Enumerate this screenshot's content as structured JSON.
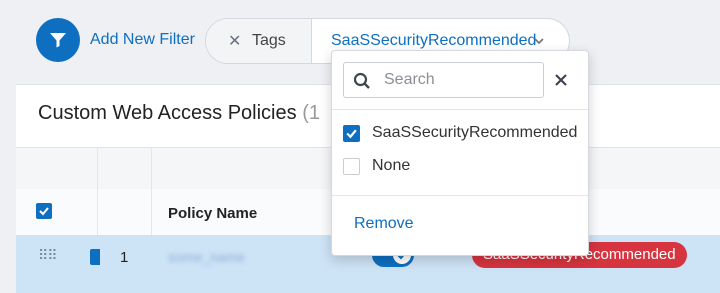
{
  "filter_bar": {
    "add_filter_label": "Add New Filter",
    "pill": {
      "field_label": "Tags",
      "value_label": "SaaSSecurityRecommended"
    }
  },
  "panel": {
    "title": "Custom Web Access Policies",
    "title_count": "(1"
  },
  "table": {
    "columns": {
      "policy_name": "Policy Name"
    },
    "rows": [
      {
        "number": "1",
        "name": "some_name",
        "tag": "SaaSSecurityRecommended",
        "enabled": true
      }
    ]
  },
  "dropdown": {
    "search_placeholder": "Search",
    "options": [
      {
        "label": "SaaSSecurityRecommended",
        "checked": true
      },
      {
        "label": "None",
        "checked": false
      }
    ],
    "remove_label": "Remove"
  },
  "colors": {
    "accent": "#0e6fc0",
    "row_selected": "#cde3f6",
    "tag_badge": "#d6343f"
  },
  "icons": [
    "filter-icon",
    "close-icon",
    "chevron-down-icon",
    "search-icon",
    "drag-handle-icon",
    "check-icon"
  ]
}
